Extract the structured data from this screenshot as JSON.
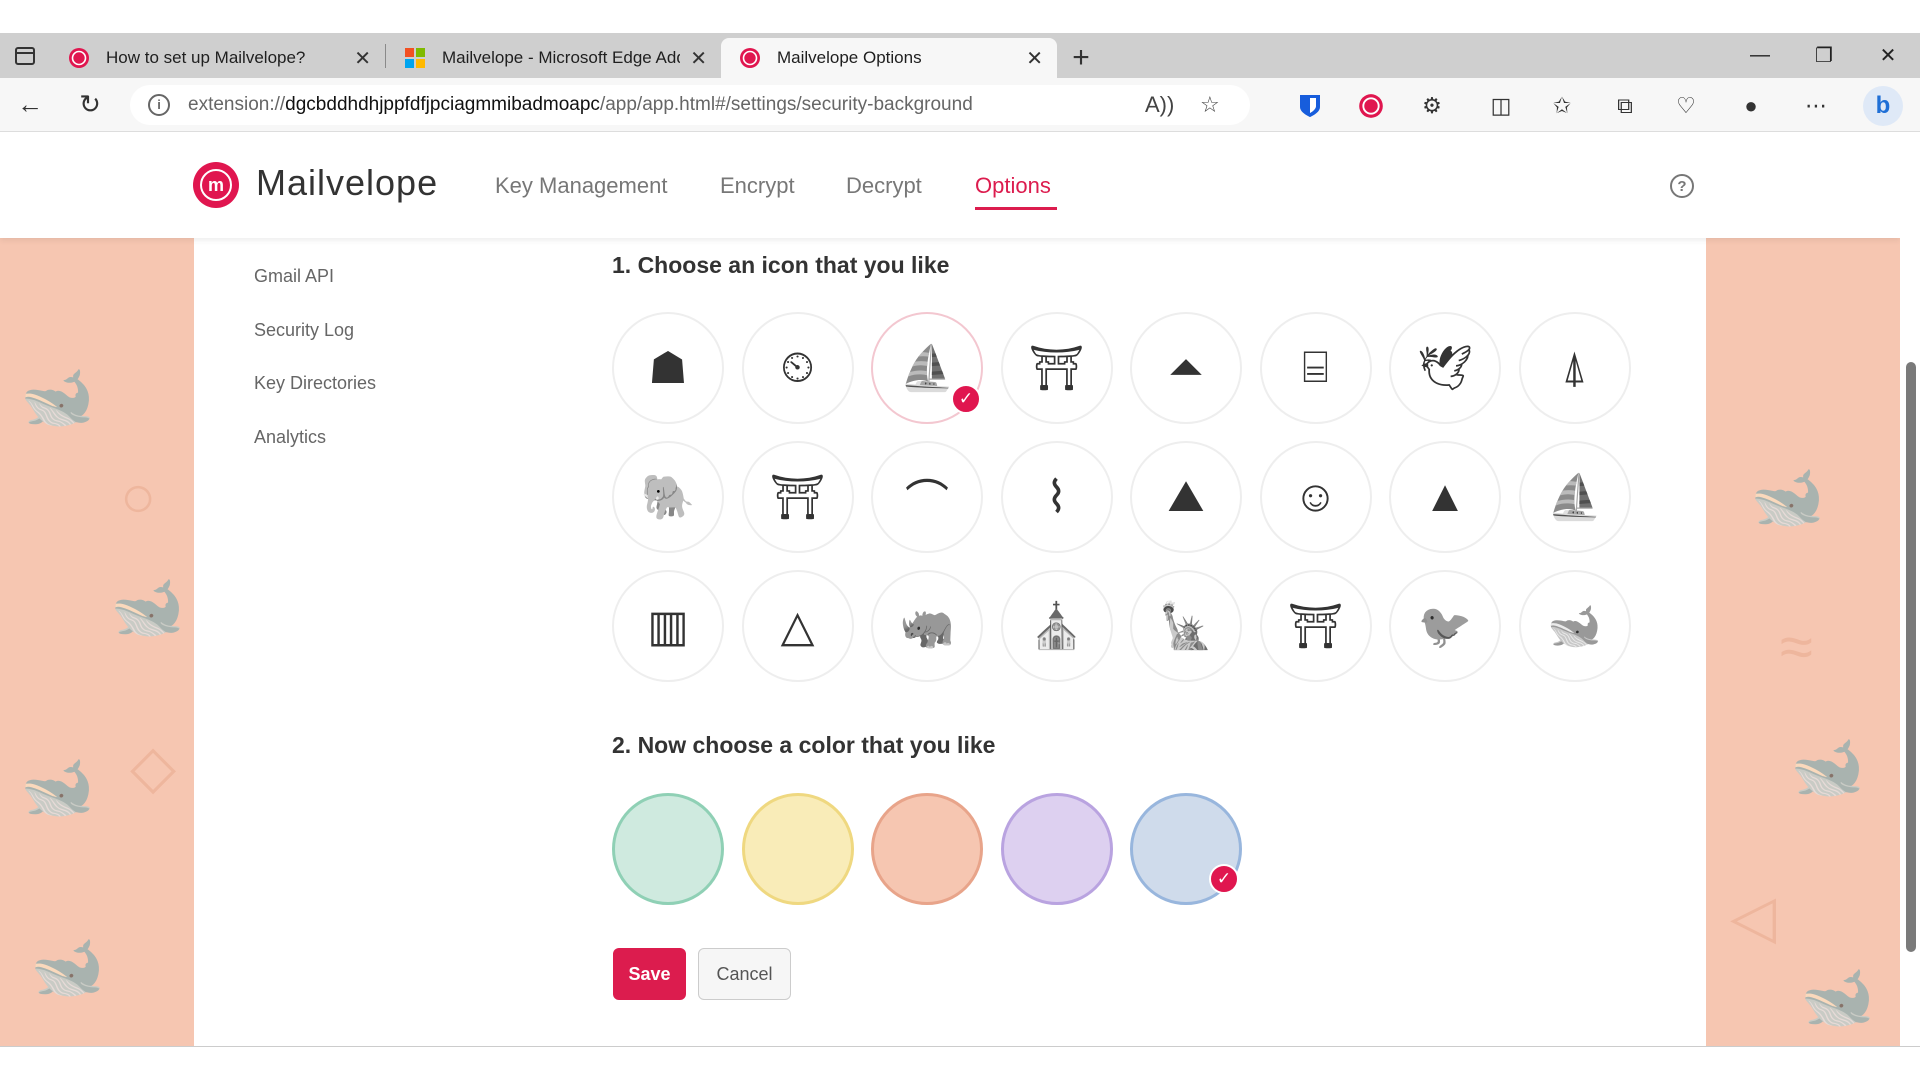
{
  "browser": {
    "tabs": [
      {
        "label": "How to set up Mailvelope?",
        "active": false
      },
      {
        "label": "Mailvelope - Microsoft Edge Add",
        "active": false
      },
      {
        "label": "Mailvelope Options",
        "active": true
      }
    ],
    "close_glyph": "✕",
    "new_tab_glyph": "+",
    "url": {
      "scheme": "extension://",
      "host": "dgcbddhdhjppfdfjpciagmmibadmoapc",
      "path": "/app/app.html#/settings/security-background"
    },
    "icons": [
      "sidebar-toggle-icon",
      "back-icon",
      "refresh-icon",
      "info-icon",
      "read-aloud-icon",
      "favorite-star-icon",
      "bitwarden-icon",
      "mailvelope-ext-icon",
      "extensions-icon",
      "split-screen-icon",
      "favorites-icon",
      "collections-icon",
      "health-icon",
      "profile-icon",
      "more-icon",
      "bing-icon"
    ]
  },
  "header": {
    "brand": "Mailvelope",
    "nav": [
      "Key Management",
      "Encrypt",
      "Decrypt",
      "Options"
    ],
    "active_nav": "Options",
    "help_glyph": "?"
  },
  "sidebar": {
    "items": [
      "Gmail API",
      "Security Log",
      "Key Directories",
      "Analytics"
    ]
  },
  "main": {
    "icon_heading": "1. Choose an icon that you like",
    "icons": [
      {
        "name": "mask-icon",
        "glyph": "☗"
      },
      {
        "name": "big-ben-icon",
        "glyph": "⏲"
      },
      {
        "name": "ship-icon",
        "glyph": "⛵",
        "selected": true
      },
      {
        "name": "brandenburg-gate-icon",
        "glyph": "⛩"
      },
      {
        "name": "pyramid-temple-icon",
        "glyph": "⏶"
      },
      {
        "name": "colosseum-icon",
        "glyph": "⌸"
      },
      {
        "name": "eagle-icon",
        "glyph": "🕊"
      },
      {
        "name": "eiffel-tower-icon",
        "glyph": "⍋"
      },
      {
        "name": "elephant-icon",
        "glyph": "🐘"
      },
      {
        "name": "pagoda-icon",
        "glyph": "⛩"
      },
      {
        "name": "bridge-icon",
        "glyph": "⌒"
      },
      {
        "name": "great-wall-icon",
        "glyph": "⌇"
      },
      {
        "name": "landscape-icon",
        "glyph": "⛰"
      },
      {
        "name": "moai-icon",
        "glyph": "☺"
      },
      {
        "name": "mountain-icon",
        "glyph": "▲"
      },
      {
        "name": "opera-house-icon",
        "glyph": "⛵"
      },
      {
        "name": "leaning-tower-icon",
        "glyph": "▥"
      },
      {
        "name": "pyramids-icon",
        "glyph": "△"
      },
      {
        "name": "rhino-icon",
        "glyph": "🦏"
      },
      {
        "name": "cathedral-icon",
        "glyph": "⛪"
      },
      {
        "name": "statue-of-liberty-icon",
        "glyph": "🗽"
      },
      {
        "name": "torii-gate-icon",
        "glyph": "⛩"
      },
      {
        "name": "toucan-icon",
        "glyph": "🐦"
      },
      {
        "name": "whale-icon",
        "glyph": "🐋"
      }
    ],
    "color_heading": "2. Now choose a color that you like",
    "colors": [
      {
        "name": "color-mint",
        "fill": "#cfeadf",
        "border": "#8fd0b5"
      },
      {
        "name": "color-yellow",
        "fill": "#f9ecb8",
        "border": "#efd880"
      },
      {
        "name": "color-peach",
        "fill": "#f6c6b1",
        "border": "#e8a48a"
      },
      {
        "name": "color-lavender",
        "fill": "#ddd0f0",
        "border": "#b9a3e0"
      },
      {
        "name": "color-blue",
        "fill": "#cfdbeb",
        "border": "#98b6dd",
        "selected": true
      }
    ],
    "check_glyph": "✓",
    "save_label": "Save",
    "cancel_label": "Cancel"
  },
  "colors": {
    "accent": "#dc1c4e",
    "page_bg": "#f6c6b1"
  }
}
